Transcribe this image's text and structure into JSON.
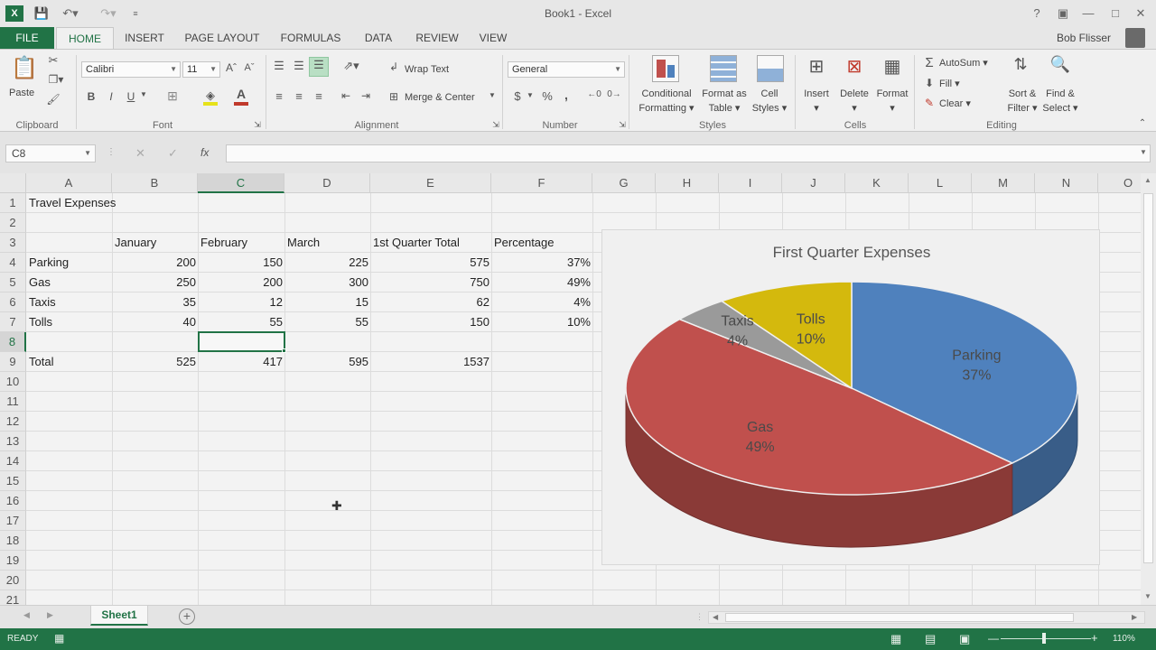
{
  "window": {
    "title": "Book1 - Excel",
    "user": "Bob Flisser"
  },
  "qat": {
    "icons": [
      "excel-logo",
      "save-icon",
      "undo-icon",
      "redo-icon",
      "customize-icon"
    ]
  },
  "tabs": [
    "FILE",
    "HOME",
    "INSERT",
    "PAGE LAYOUT",
    "FORMULAS",
    "DATA",
    "REVIEW",
    "VIEW"
  ],
  "ribbon": {
    "clipboard": {
      "group": "Clipboard",
      "paste": "Paste"
    },
    "font": {
      "group": "Font",
      "name": "Calibri",
      "size": "11",
      "bold": "B",
      "italic": "I",
      "underline": "U"
    },
    "alignment": {
      "group": "Alignment",
      "wrap": "Wrap Text",
      "merge": "Merge & Center"
    },
    "number": {
      "group": "Number",
      "format": "General",
      "currency": "$",
      "percent": "%",
      "comma": ","
    },
    "styles": {
      "group": "Styles",
      "cond1": "Conditional",
      "cond2": "Formatting",
      "fmt1": "Format as",
      "fmt2": "Table",
      "cs1": "Cell",
      "cs2": "Styles"
    },
    "cells": {
      "group": "Cells",
      "insert": "Insert",
      "delete": "Delete",
      "format": "Format"
    },
    "editing": {
      "group": "Editing",
      "autosum": "AutoSum",
      "fill": "Fill",
      "clear": "Clear",
      "sort1": "Sort &",
      "sort2": "Filter",
      "find1": "Find &",
      "find2": "Select"
    }
  },
  "formula": {
    "namebox": "C8",
    "fx": "fx",
    "value": ""
  },
  "columns": [
    "A",
    "B",
    "C",
    "D",
    "E",
    "F",
    "G",
    "H",
    "I",
    "J",
    "K",
    "L",
    "M",
    "N",
    "O"
  ],
  "rows": [
    "1",
    "2",
    "3",
    "4",
    "5",
    "6",
    "7",
    "8",
    "9",
    "10",
    "11",
    "12",
    "13",
    "14",
    "15",
    "16",
    "17",
    "18",
    "19",
    "20",
    "21"
  ],
  "cells": {
    "a1": "Travel Expenses",
    "b3": "January",
    "c3": "February",
    "d3": "March",
    "e3": "1st Quarter Total",
    "f3": "Percentage",
    "a4": "Parking",
    "b4": "200",
    "c4": "150",
    "d4": "225",
    "e4": "575",
    "f4": "37%",
    "a5": "Gas",
    "b5": "250",
    "c5": "200",
    "d5": "300",
    "e5": "750",
    "f5": "49%",
    "a6": "Taxis",
    "b6": "35",
    "c6": "12",
    "d6": "15",
    "e6": "62",
    "f6": "4%",
    "a7": "Tolls",
    "b7": "40",
    "c7": "55",
    "d7": "55",
    "e7": "150",
    "f7": "10%",
    "a9": "Total",
    "b9": "525",
    "c9": "417",
    "d9": "595",
    "e9": "1537"
  },
  "chart_data": {
    "type": "pie",
    "title": "First Quarter Expenses",
    "categories": [
      "Parking",
      "Gas",
      "Taxis",
      "Tolls"
    ],
    "values": [
      575,
      750,
      62,
      150
    ],
    "labels": [
      "37%",
      "49%",
      "4%",
      "10%"
    ],
    "colors": [
      "#4f81bd",
      "#c0504d",
      "#9a9a9a",
      "#d4b90d"
    ]
  },
  "sheets": [
    "Sheet1"
  ],
  "status": {
    "ready": "READY",
    "zoom": "110%"
  }
}
